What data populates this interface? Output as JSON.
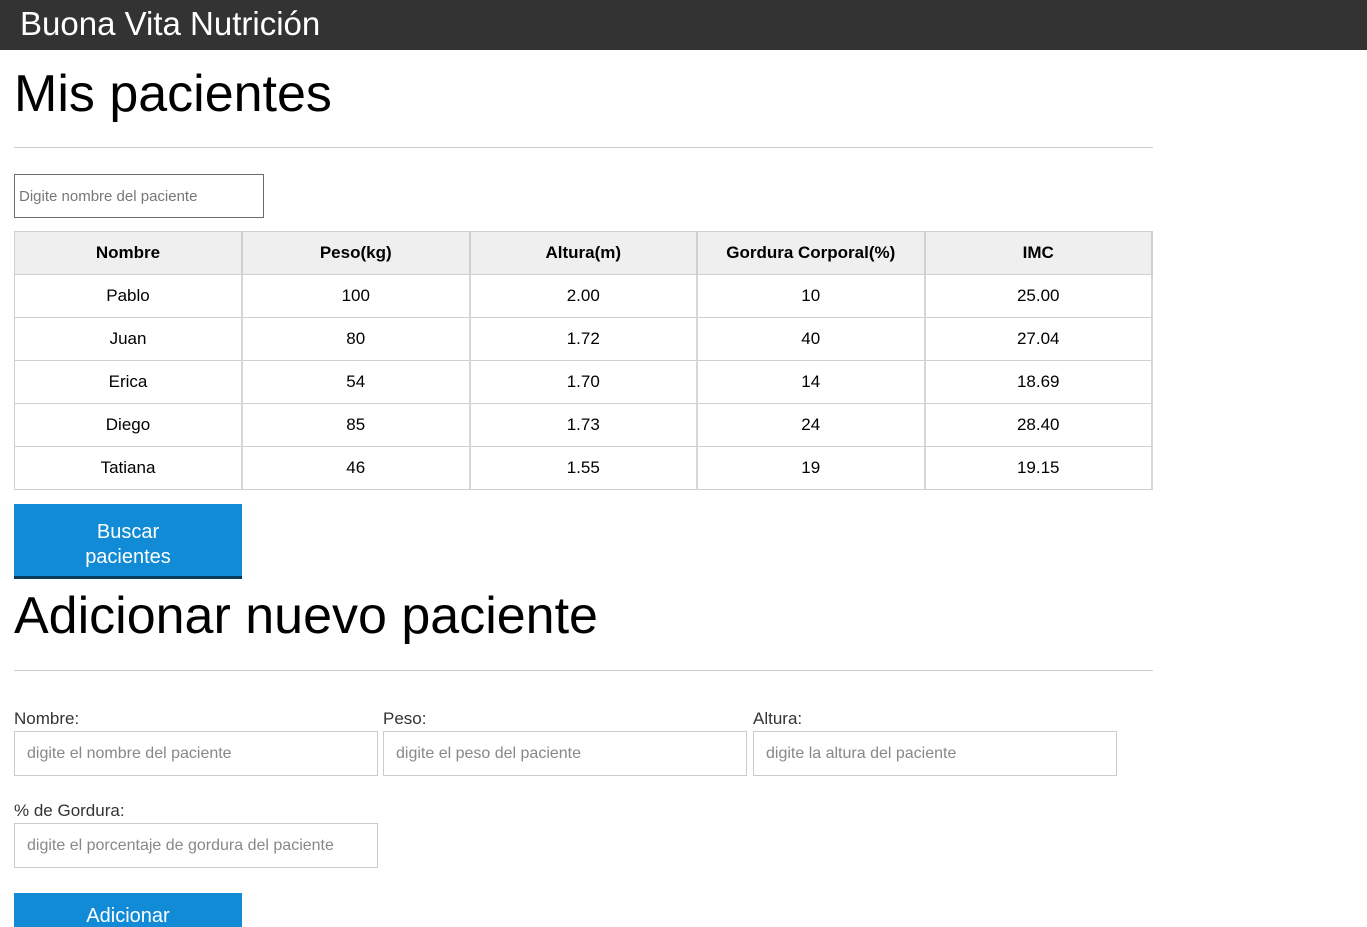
{
  "header": {
    "brand": "Buona Vita Nutrición"
  },
  "patients_section": {
    "title": "Mis pacientes",
    "filter_placeholder": "Digite nombre del paciente",
    "table": {
      "columns": [
        "Nombre",
        "Peso(kg)",
        "Altura(m)",
        "Gordura Corporal(%)",
        "IMC"
      ],
      "rows": [
        [
          "Pablo",
          "100",
          "2.00",
          "10",
          "25.00"
        ],
        [
          "Juan",
          "80",
          "1.72",
          "40",
          "27.04"
        ],
        [
          "Erica",
          "54",
          "1.70",
          "14",
          "18.69"
        ],
        [
          "Diego",
          "85",
          "1.73",
          "24",
          "28.40"
        ],
        [
          "Tatiana",
          "46",
          "1.55",
          "19",
          "19.15"
        ]
      ]
    },
    "search_button": "Buscar pacientes"
  },
  "add_section": {
    "title": "Adicionar nuevo paciente",
    "fields": {
      "nombre": {
        "label": "Nombre:",
        "placeholder": "digite el nombre del paciente"
      },
      "peso": {
        "label": "Peso:",
        "placeholder": "digite el peso del paciente"
      },
      "altura": {
        "label": "Altura:",
        "placeholder": "digite la altura del paciente"
      },
      "gordura": {
        "label": "% de Gordura:",
        "placeholder": "digite el porcentaje de gordura del paciente"
      }
    },
    "add_button": "Adicionar"
  },
  "colors": {
    "header_bg": "#333333",
    "button_bg": "#128bd6"
  }
}
